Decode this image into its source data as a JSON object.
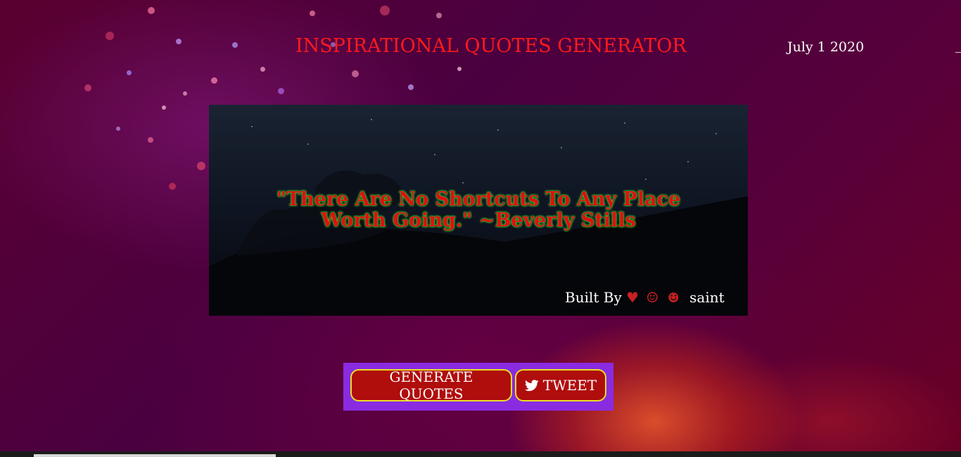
{
  "header": {
    "title": "INSPIRATIONAL QUOTES GENERATOR",
    "date": "July 1 2020"
  },
  "quote": {
    "text": "\"There Are No Shortcuts To Any Place Worth Going.\" ~Beverly Stills"
  },
  "footer_credit": {
    "label": "Built By",
    "heart_glyph": "♥",
    "smile_glyph": "☺",
    "smile_solid_glyph": "☻",
    "author": "saint"
  },
  "actions": {
    "generate_label": "GENERATE QUOTES",
    "tweet_label": "TWEET",
    "tweet_icon": "twitter-bird-icon"
  },
  "colors": {
    "title": "#ff1a1a",
    "button_bar": "#8a2be2",
    "button_bg": "#b00d0d",
    "button_border": "#e8e020",
    "quote_text": "#e01010",
    "quote_glow": "#3cff3c"
  }
}
